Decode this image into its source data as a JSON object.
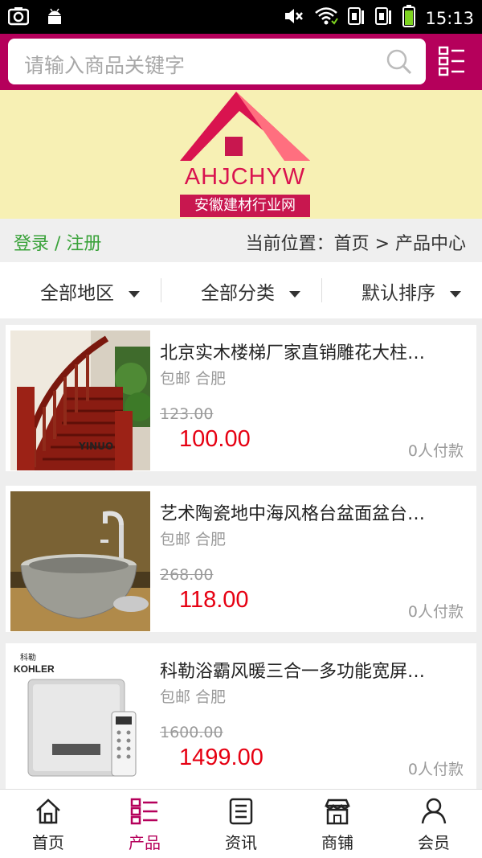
{
  "status_bar": {
    "time": "15:13"
  },
  "search": {
    "placeholder": "请输入商品关键字"
  },
  "banner": {
    "logo_text": "AHJCHYW",
    "logo_subtitle": "安徽建材行业网"
  },
  "crumbs": {
    "login": "登录 / 注册",
    "location": "当前位置：首页 > 产品中心"
  },
  "filters": [
    {
      "label": "全部地区"
    },
    {
      "label": "全部分类"
    },
    {
      "label": "默认排序"
    }
  ],
  "products": [
    {
      "title": "北京实木楼梯厂家直销雕花大柱…",
      "shipping": "包邮 合肥",
      "old_price": "123.00",
      "price": "100.00",
      "paid": "0人付款",
      "watermark": "YINUO"
    },
    {
      "title": "艺术陶瓷地中海风格台盆面盆台…",
      "shipping": "包邮 合肥",
      "old_price": "268.00",
      "price": "118.00",
      "paid": "0人付款"
    },
    {
      "title": "科勒浴霸风暖三合一多功能宽屏…",
      "shipping": "包邮 合肥",
      "old_price": "1600.00",
      "price": "1499.00",
      "paid": "0人付款",
      "brand": "KOHLER",
      "brand_cn": "科勒"
    }
  ],
  "nav": [
    {
      "label": "首页",
      "icon": "home-icon"
    },
    {
      "label": "产品",
      "icon": "product-list-icon",
      "active": true
    },
    {
      "label": "资讯",
      "icon": "news-icon"
    },
    {
      "label": "商铺",
      "icon": "shop-icon"
    },
    {
      "label": "会员",
      "icon": "user-icon"
    }
  ],
  "colors": {
    "brand": "#b5005b",
    "price": "#e60012",
    "login": "#3aa23a",
    "banner_bg": "#f7f0b4"
  }
}
